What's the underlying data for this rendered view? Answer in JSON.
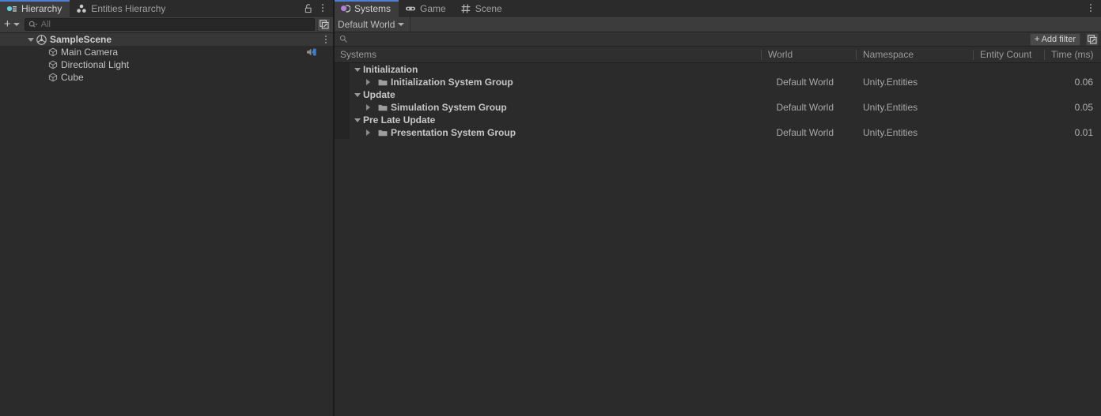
{
  "colors": {
    "window_bg": "#2b2b2b",
    "tab_active_bg": "#3c3c3c",
    "tab_accent": "#4f7fd4",
    "toolbar_bg": "#3c3c3c",
    "header_bg": "#2f2f2f",
    "row_selected_bg": "#373737",
    "text": "#b4b4b4",
    "systems_tab_icon": "#b07fd8",
    "hierarchy_tab_icon": "#5fd0e0",
    "audio_icon": "#3b7fd4"
  },
  "left_panel": {
    "tabs": [
      {
        "label": "Hierarchy",
        "icon": "hierarchy-icon",
        "active": true
      },
      {
        "label": "Entities Hierarchy",
        "icon": "entities-hierarchy-icon",
        "active": false
      }
    ],
    "tab_actions": [
      {
        "name": "lock-icon",
        "label": "Lock"
      },
      {
        "name": "panel-menu-kebab-icon",
        "label": "Menu"
      }
    ],
    "toolbar": {
      "add_label": "+",
      "add_dropdown_icon": "chevron-down-icon",
      "search": {
        "placeholder": "All",
        "value": "All",
        "icon": "search-dropdown-icon"
      },
      "popout_icon": "popout-icon"
    },
    "tree": [
      {
        "label": "SampleScene",
        "icon": "unity-scene-icon",
        "depth": 0,
        "expanded": true,
        "selected": true,
        "has_kebab": true
      },
      {
        "label": "Main Camera",
        "icon": "gameobject-cube-icon",
        "depth": 1,
        "expanded": false,
        "selected": false,
        "right_icon": "audio-listener-icon"
      },
      {
        "label": "Directional Light",
        "icon": "gameobject-cube-icon",
        "depth": 1,
        "expanded": false,
        "selected": false
      },
      {
        "label": "Cube",
        "icon": "gameobject-cube-icon",
        "depth": 1,
        "expanded": false,
        "selected": false
      }
    ]
  },
  "right_panel": {
    "tabs": [
      {
        "label": "Systems",
        "icon": "systems-icon",
        "active": true
      },
      {
        "label": "Game",
        "icon": "gamepad-icon",
        "active": false
      },
      {
        "label": "Scene",
        "icon": "grid-icon",
        "active": false
      }
    ],
    "tab_actions": [
      {
        "name": "panel-menu-kebab-icon",
        "label": "Menu"
      }
    ],
    "world_selector": {
      "label": "Default World",
      "icon": "chevron-down-icon"
    },
    "search": {
      "placeholder": "",
      "value": "",
      "icon": "search-icon"
    },
    "add_filter": {
      "label": "Add filter",
      "plus": "+",
      "popout_icon": "popout-icon"
    },
    "table": {
      "columns": [
        {
          "key": "systems",
          "label": "Systems"
        },
        {
          "key": "world",
          "label": "World"
        },
        {
          "key": "namespace",
          "label": "Namespace"
        },
        {
          "key": "entity_count",
          "label": "Entity Count"
        },
        {
          "key": "time_ms",
          "label": "Time (ms)"
        }
      ],
      "rows": [
        {
          "type": "group",
          "depth": 0,
          "expanded": true,
          "systems": "Initialization",
          "world": "",
          "namespace": "",
          "entity_count": "",
          "time_ms": ""
        },
        {
          "type": "system-group",
          "depth": 1,
          "expanded": false,
          "icon": "folder-icon",
          "systems": "Initialization System Group",
          "world": "Default World",
          "namespace": "Unity.Entities",
          "entity_count": "",
          "time_ms": "0.06"
        },
        {
          "type": "group",
          "depth": 0,
          "expanded": true,
          "systems": "Update",
          "world": "",
          "namespace": "",
          "entity_count": "",
          "time_ms": ""
        },
        {
          "type": "system-group",
          "depth": 1,
          "expanded": false,
          "icon": "folder-icon",
          "systems": "Simulation System Group",
          "world": "Default World",
          "namespace": "Unity.Entities",
          "entity_count": "",
          "time_ms": "0.05"
        },
        {
          "type": "group",
          "depth": 0,
          "expanded": true,
          "systems": "Pre Late Update",
          "world": "",
          "namespace": "",
          "entity_count": "",
          "time_ms": ""
        },
        {
          "type": "system-group",
          "depth": 1,
          "expanded": false,
          "icon": "folder-icon",
          "systems": "Presentation System Group",
          "world": "Default World",
          "namespace": "Unity.Entities",
          "entity_count": "",
          "time_ms": "0.01"
        }
      ]
    }
  }
}
